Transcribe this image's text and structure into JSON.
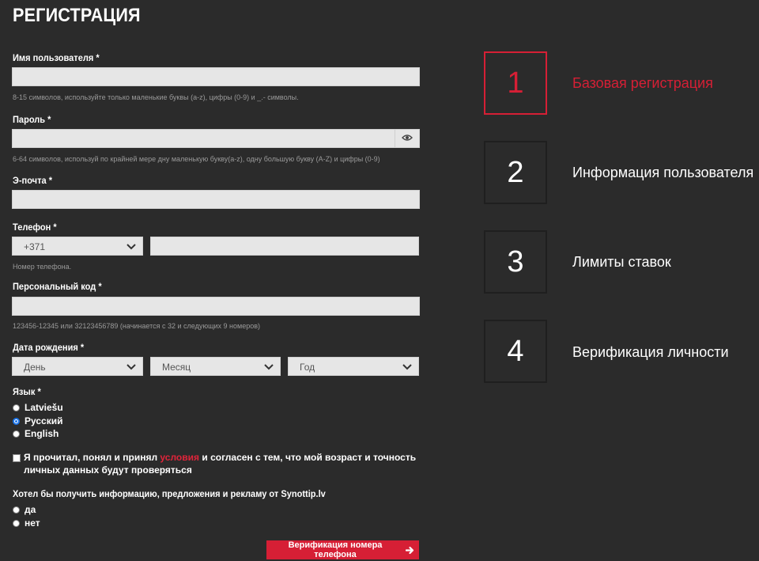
{
  "page": {
    "title": "РЕГИСТРАЦИЯ"
  },
  "form": {
    "username": {
      "label": "Имя пользователя *",
      "value": "",
      "hint": "8-15 символов, используйте только маленькие буквы (a-z), цифры (0-9) и _.- символы."
    },
    "password": {
      "label": "Пароль *",
      "value": "",
      "hint": "6-64 символов, используй по крайней мере дну маленькую букву(a-z), одну большую букву (A-Z) и цифры (0-9)",
      "toggle_icon": "eye-icon"
    },
    "email": {
      "label": "Э-почта *",
      "value": ""
    },
    "phone": {
      "label": "Телефон *",
      "country_code": "+371",
      "value": "",
      "hint": "Номер телефона."
    },
    "personal_code": {
      "label": "Персональный код *",
      "value": "",
      "hint": "123456-12345 или 32123456789 (начинается с 32 и следующих 9 номеров)"
    },
    "birthdate": {
      "label": "Дата рождения *",
      "day": "День",
      "month": "Месяц",
      "year": "Год"
    },
    "language": {
      "label": "Язык *",
      "options": [
        {
          "label": "Latviešu",
          "checked": false
        },
        {
          "label": "Русский",
          "checked": true
        },
        {
          "label": "English",
          "checked": false
        }
      ]
    },
    "consent": {
      "checked": false,
      "text_before": "Я прочитал, понял и принял ",
      "link_text": "условия",
      "text_after": " и согласен с тем, что мой возраст и точность личных данных будут проверяться"
    },
    "marketing": {
      "label": "Хотел бы получить информацию, предложения и рекламу от Synottip.lv",
      "options": [
        {
          "label": "да",
          "checked": false
        },
        {
          "label": "нет",
          "checked": false
        }
      ]
    },
    "submit": {
      "label": "Верификация номера телефона",
      "icon": "arrow-right-icon"
    }
  },
  "steps": [
    {
      "number": "1",
      "label": "Базовая регистрация",
      "active": true
    },
    {
      "number": "2",
      "label": "Информация пользователя",
      "active": false
    },
    {
      "number": "3",
      "label": "Лимиты ставок",
      "active": false
    },
    {
      "number": "4",
      "label": "Верификация личности",
      "active": false
    }
  ],
  "colors": {
    "background": "#2b2b2b",
    "accent": "#d61f35",
    "field": "#e6e6e6",
    "hint": "#9a9a9a",
    "step_border": "#1f1f1f"
  }
}
